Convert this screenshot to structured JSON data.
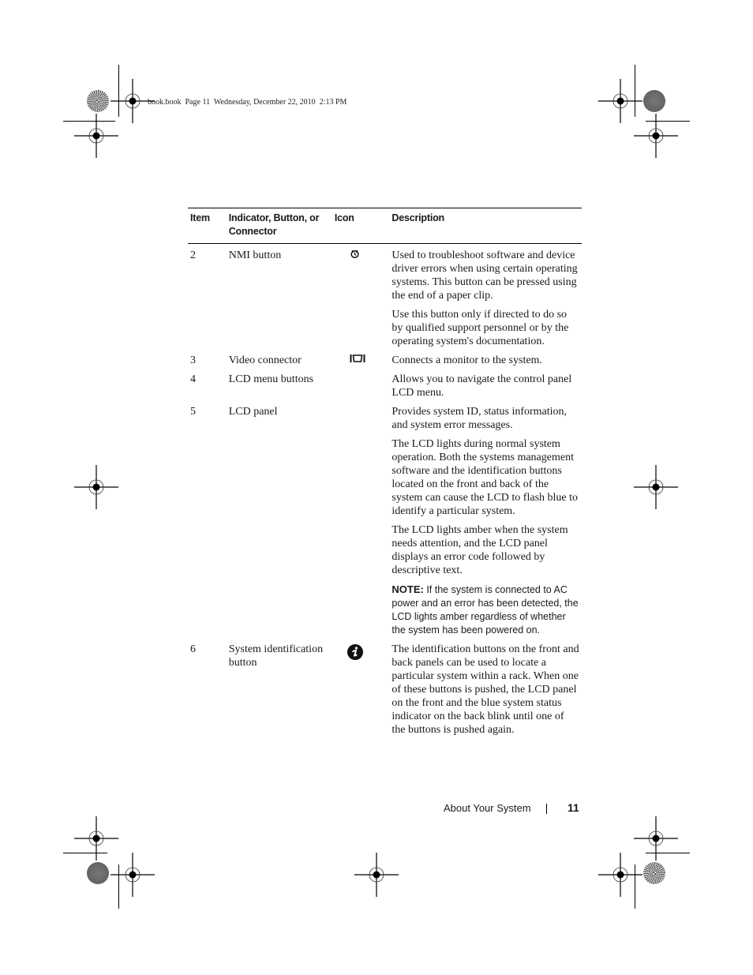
{
  "slug": {
    "text": "book.book  Page 11  Wednesday, December 22, 2010  2:13 PM"
  },
  "table": {
    "headers": {
      "item": "Item",
      "name": "Indicator, Button, or Connector",
      "icon": "Icon",
      "description": "Description"
    },
    "rows": [
      {
        "item": "2",
        "name": "NMI button",
        "icon": "nmi-icon",
        "paragraphs": [
          "Used to troubleshoot software and device driver errors when using certain operating systems. This button can be pressed using the end of a paper clip.",
          "Use this button only if directed to do so by qualified support personnel or by the operating system's documentation."
        ]
      },
      {
        "item": "3",
        "name": "Video connector",
        "icon": "video-connector-icon",
        "paragraphs": [
          "Connects a monitor to the system."
        ]
      },
      {
        "item": "4",
        "name": "LCD menu buttons",
        "icon": "",
        "paragraphs": [
          "Allows you to navigate the control panel LCD menu."
        ]
      },
      {
        "item": "5",
        "name": "LCD panel",
        "icon": "",
        "paragraphs": [
          "Provides system ID, status information, and system error messages.",
          "The LCD lights during normal system operation. Both the systems management software and the identification buttons located on the front and back of the system can cause the LCD to flash blue to identify a particular system.",
          "The LCD lights amber when the system needs attention, and the LCD panel displays an error code followed by descriptive text."
        ],
        "note": {
          "label": "NOTE:",
          "text": " If the system is connected to AC power and an error has been detected, the LCD lights amber regardless of whether the system has been powered on."
        }
      },
      {
        "item": "6",
        "name": "System identification button",
        "icon": "system-id-info-icon",
        "paragraphs": [
          "The identification buttons on the front and back panels can be used to locate a particular system within a rack. When one of these buttons is pushed, the LCD panel on the front and the blue system status indicator on the back blink until one of the buttons is pushed again."
        ]
      }
    ]
  },
  "footer": {
    "section_title": "About Your System",
    "page_number": "11"
  }
}
